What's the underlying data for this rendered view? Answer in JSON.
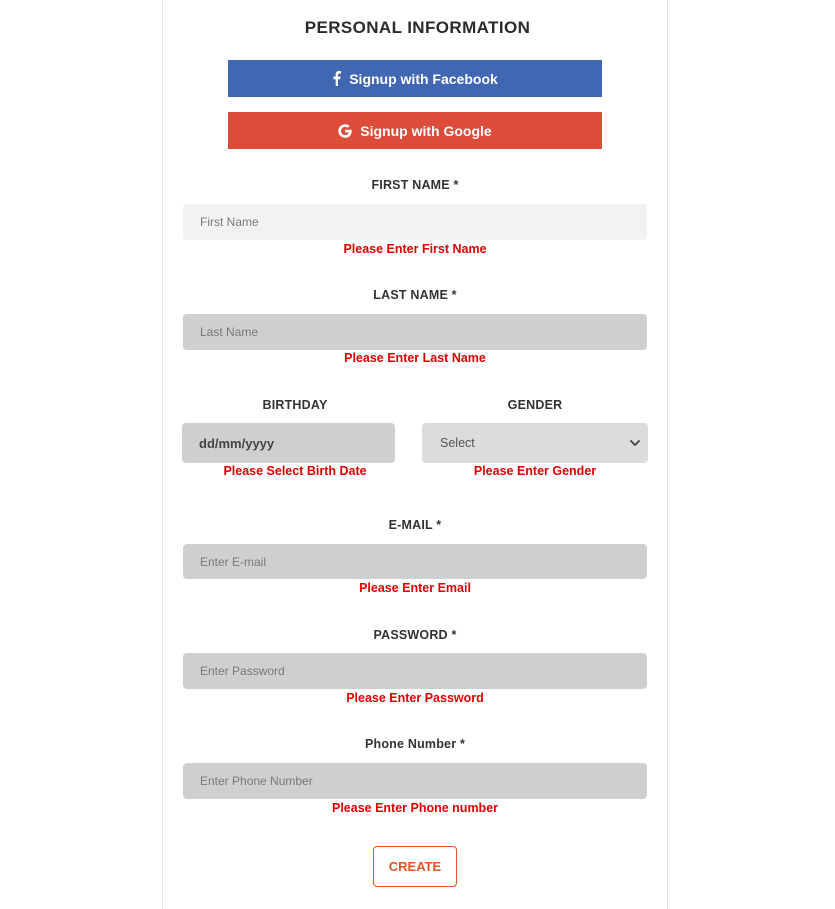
{
  "form": {
    "title": "PERSONAL INFORMATION",
    "facebook_label": "Signup with Facebook",
    "google_label": "Signup with Google",
    "first_name": {
      "label": "FIRST NAME *",
      "placeholder": "First Name",
      "error": "Please Enter First Name"
    },
    "last_name": {
      "label": "LAST NAME *",
      "placeholder": "Last Name",
      "error": "Please Enter Last Name"
    },
    "birthday": {
      "label": "BIRTHDAY",
      "value": "dd/mm/yyyy",
      "error": "Please Select Birth Date"
    },
    "gender": {
      "label": "GENDER",
      "selected": "Select",
      "error": "Please Enter Gender"
    },
    "email": {
      "label": "E-MAIL *",
      "placeholder": "Enter E-mail",
      "error": "Please Enter Email"
    },
    "password": {
      "label": "PASSWORD *",
      "placeholder": "Enter Password",
      "error": "Please Enter Password"
    },
    "phone": {
      "label": "Phone Number *",
      "placeholder": "Enter Phone Number",
      "error": "Please Enter Phone number"
    },
    "create_label": "CREATE"
  },
  "colors": {
    "facebook": "#4267b2",
    "google": "#dd4b39",
    "error": "#e10000",
    "accent": "#e0541e"
  },
  "icons": {
    "facebook": "facebook-icon",
    "google": "google-icon",
    "select": "chevron-down-icon"
  }
}
